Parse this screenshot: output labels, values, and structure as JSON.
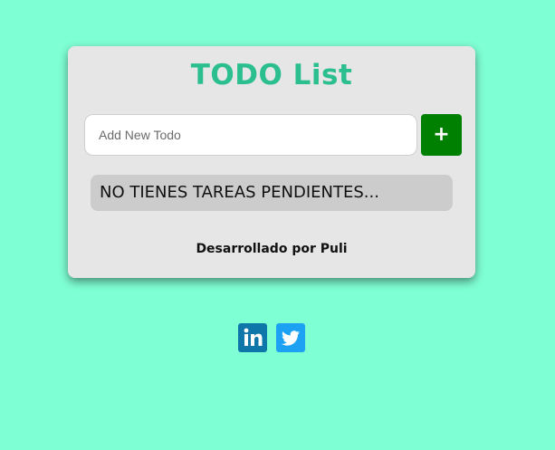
{
  "app": {
    "title": "TODO List"
  },
  "new_todo": {
    "placeholder": "Add New Todo",
    "value": "",
    "add_label": "+"
  },
  "todo_list": {
    "empty_message": "NO TIENES TAREAS PENDIENTES..."
  },
  "footer": {
    "credit": "Desarrollado por Puli"
  },
  "social": {
    "links": [
      {
        "icon": "linkedin-icon",
        "color": "#0e76a8"
      },
      {
        "icon": "twitter-icon",
        "color": "#1da1f2"
      }
    ]
  },
  "colors": {
    "background": "#7fffd4",
    "card": "#e6e6e6",
    "title": "#2bbf8f",
    "add_button": "#008000",
    "empty_message_bg": "#cccccc"
  }
}
